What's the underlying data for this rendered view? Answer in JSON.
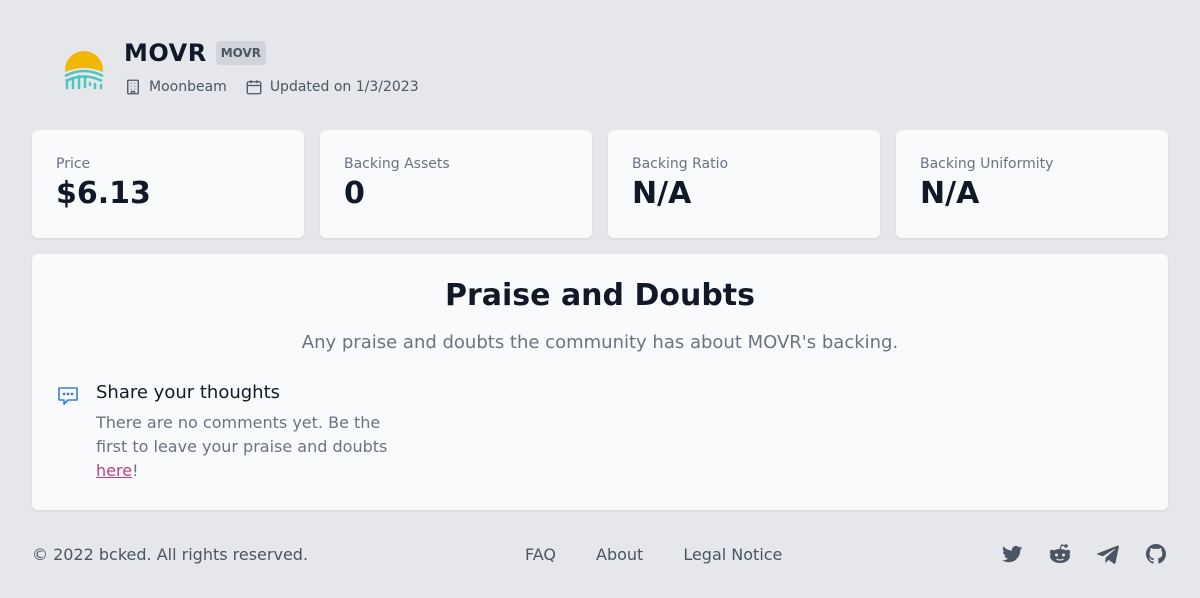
{
  "header": {
    "coin_name": "MOVR",
    "symbol": "MOVR",
    "network": "Moonbeam",
    "updated": "Updated on 1/3/2023"
  },
  "stats": [
    {
      "label": "Price",
      "value": "$6.13"
    },
    {
      "label": "Backing Assets",
      "value": "0"
    },
    {
      "label": "Backing Ratio",
      "value": "N/A"
    },
    {
      "label": "Backing Uniformity",
      "value": "N/A"
    }
  ],
  "praise": {
    "title": "Praise and Doubts",
    "subtitle": "Any praise and doubts the community has about MOVR's backing.",
    "share_heading": "Share your thoughts",
    "share_text": "There are no comments yet. Be the first to leave your praise and doubts",
    "link_text": "here",
    "suffix": "!"
  },
  "footer": {
    "copyright": "© 2022 bcked. All rights reserved.",
    "links": [
      "FAQ",
      "About",
      "Legal Notice"
    ],
    "social_icons": [
      "twitter-icon",
      "reddit-icon",
      "telegram-icon",
      "github-icon"
    ]
  },
  "colors": {
    "background": "#e6e7eb",
    "card": "#f9fafc",
    "link_accent": "#be3f7b",
    "logo_yellow": "#f2b705",
    "logo_teal": "#4ec5c1"
  }
}
